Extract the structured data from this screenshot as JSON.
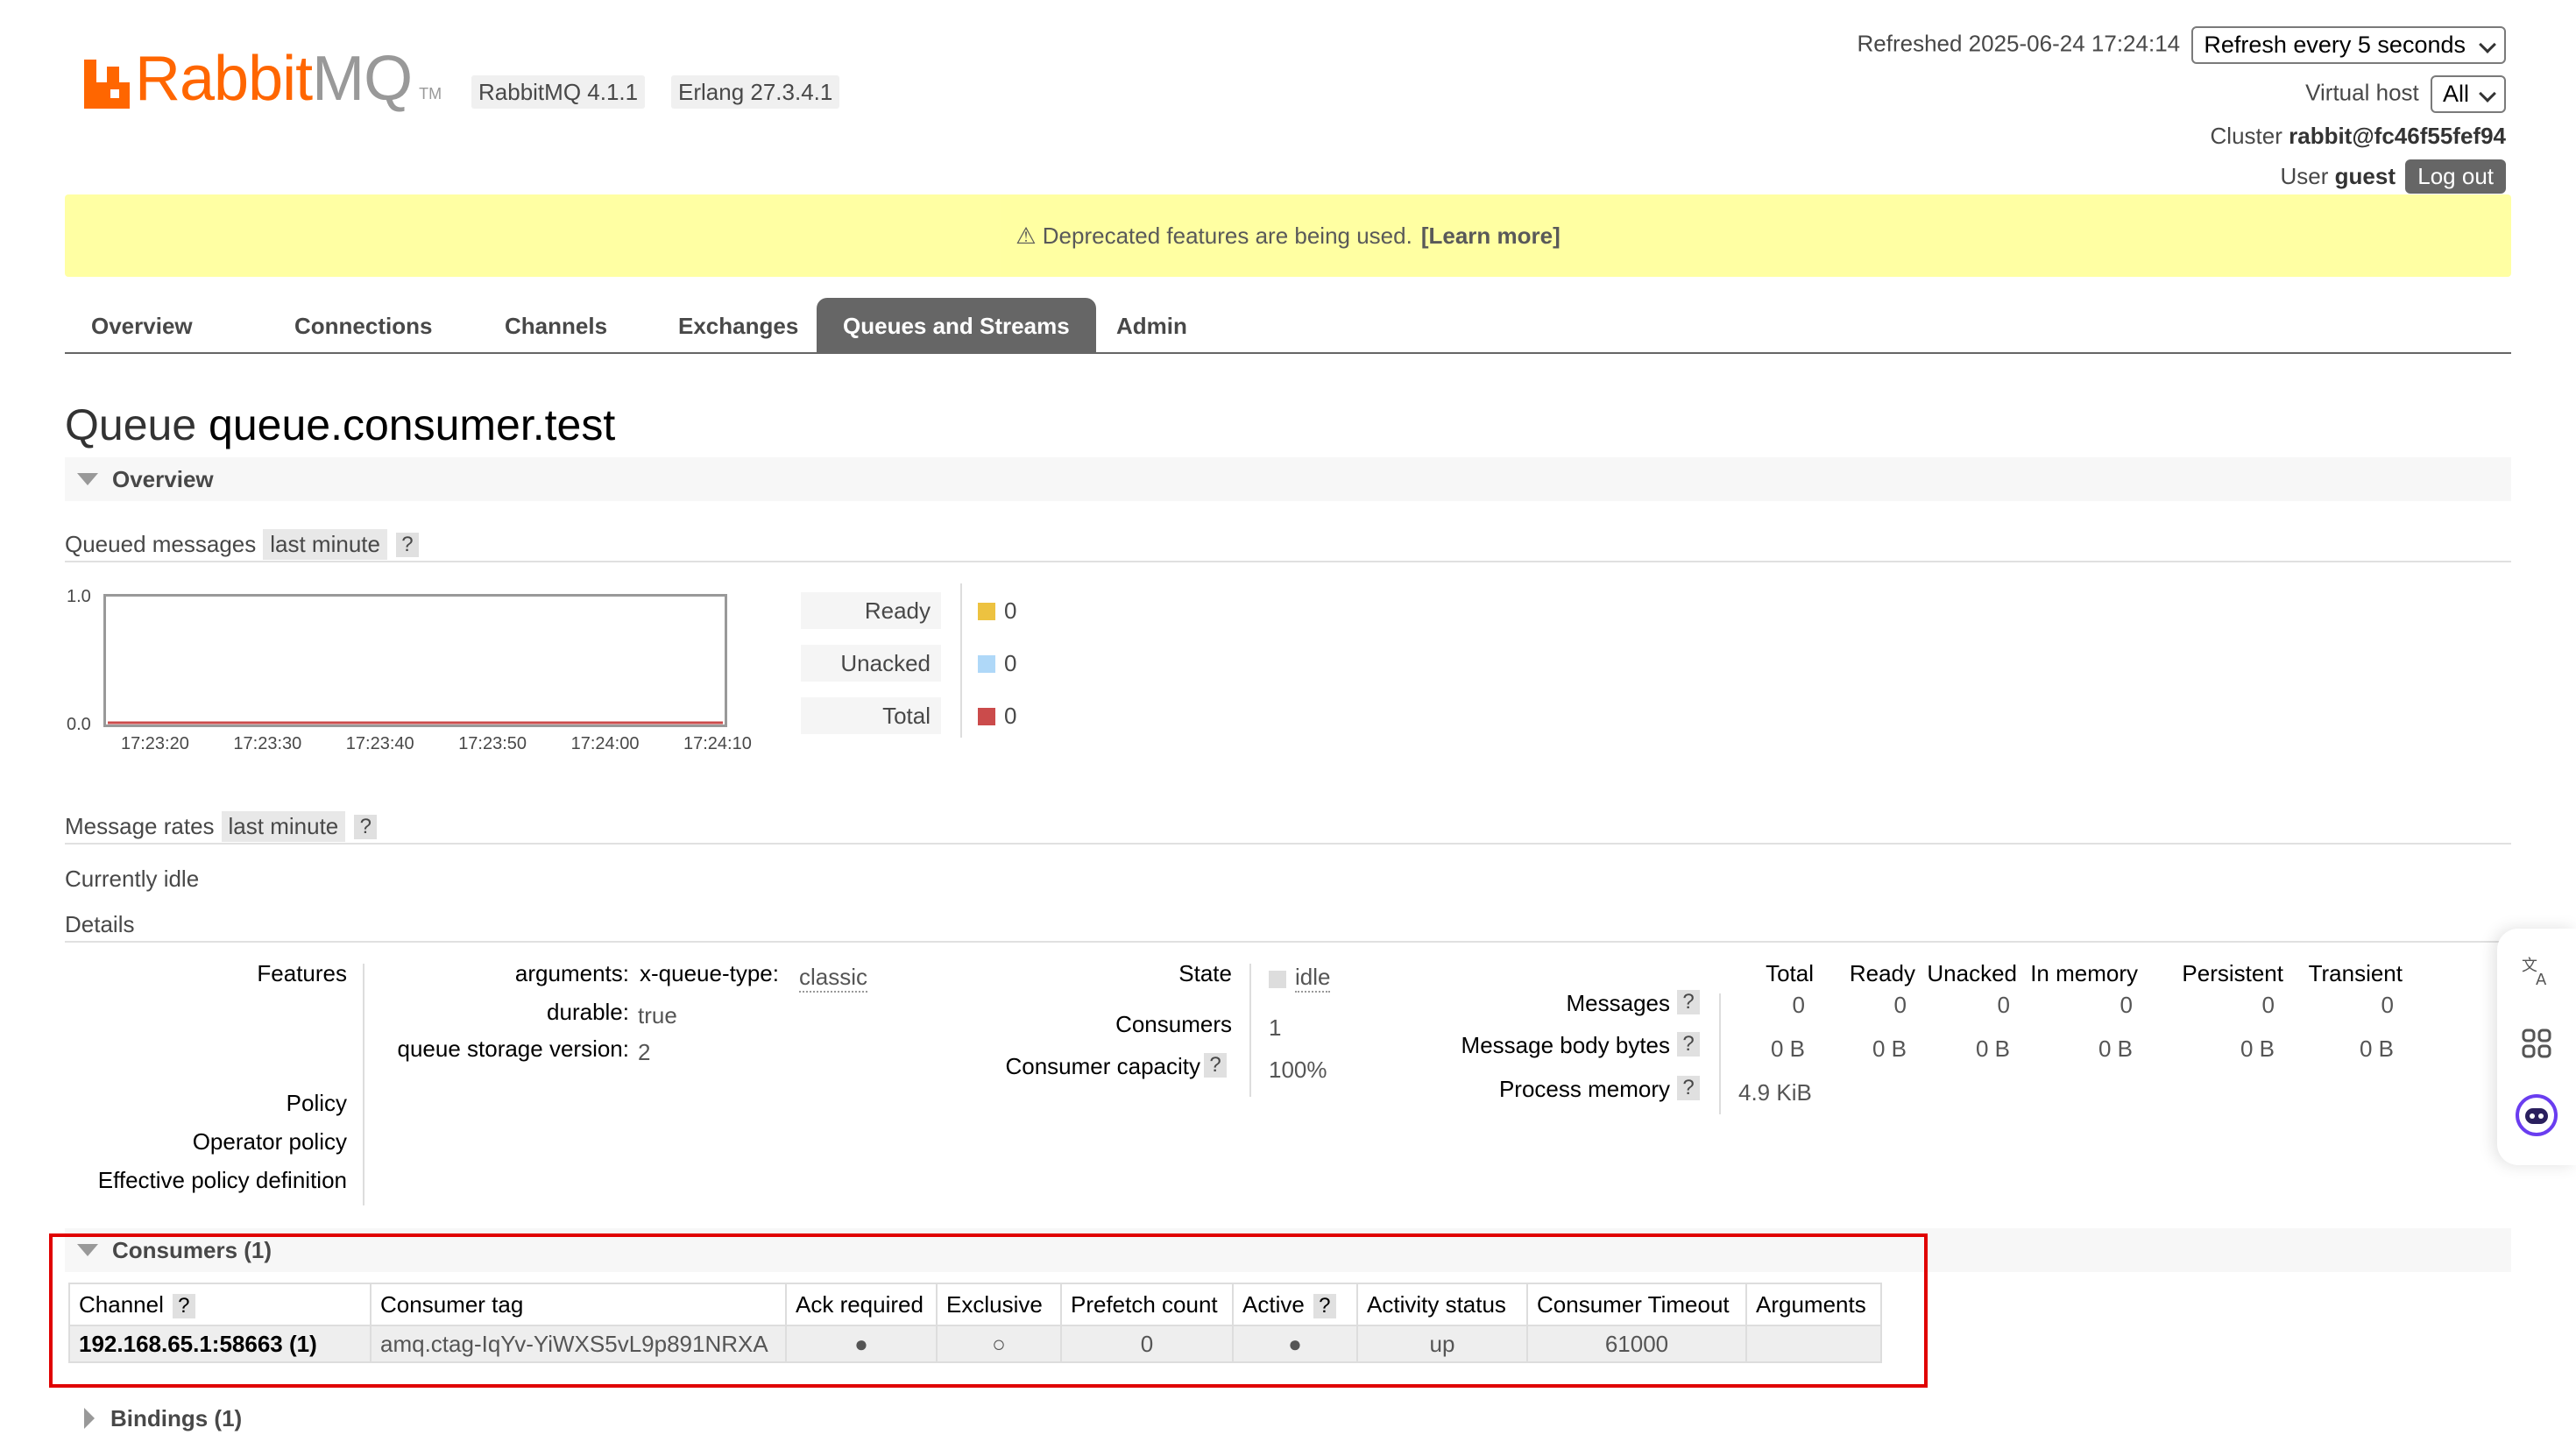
{
  "header": {
    "logo_rabbit": "Rabbit",
    "logo_mq": "MQ",
    "logo_tm": "TM",
    "rabbitmq_version": "RabbitMQ 4.1.1",
    "erlang_version": "Erlang 27.3.4.1",
    "refreshed_label": "Refreshed 2025-06-24 17:24:14",
    "refresh_select": "Refresh every 5 seconds",
    "vhost_label": "Virtual host",
    "vhost_select": "All",
    "cluster_label": "Cluster",
    "cluster_name": "rabbit@fc46f55fef94",
    "user_label": "User",
    "user_name": "guest",
    "logout_label": "Log out"
  },
  "banner": {
    "text": "⚠ Deprecated features are being used.",
    "link": "[Learn more]"
  },
  "tabs": [
    {
      "label": "Overview"
    },
    {
      "label": "Connections"
    },
    {
      "label": "Channels"
    },
    {
      "label": "Exchanges"
    },
    {
      "label": "Queues and Streams"
    },
    {
      "label": "Admin"
    }
  ],
  "page": {
    "title_prefix": "Queue",
    "queue_name": "queue.consumer.test"
  },
  "overview": {
    "section_label": "Overview",
    "queued_messages_label": "Queued messages",
    "range_pill": "last minute",
    "help": "?",
    "message_rates_label": "Message rates",
    "currently_idle": "Currently idle",
    "details_label": "Details"
  },
  "chart_data": {
    "type": "line",
    "x": [
      "17:23:20",
      "17:23:30",
      "17:23:40",
      "17:23:50",
      "17:24:00",
      "17:24:10"
    ],
    "y_tick_labels": [
      "1.0",
      "0.0"
    ],
    "ylim": [
      0,
      1
    ],
    "series": [
      {
        "name": "Ready",
        "color": "#edc240",
        "values": [
          0,
          0,
          0,
          0,
          0,
          0
        ],
        "current": "0"
      },
      {
        "name": "Unacked",
        "color": "#afd8f8",
        "values": [
          0,
          0,
          0,
          0,
          0,
          0
        ],
        "current": "0"
      },
      {
        "name": "Total",
        "color": "#cb4b4b",
        "values": [
          0,
          0,
          0,
          0,
          0,
          0
        ],
        "current": "0"
      }
    ]
  },
  "details": {
    "features_label": "Features",
    "arguments_label": "arguments:",
    "x_queue_type_label": "x-queue-type:",
    "x_queue_type_value": "classic",
    "durable_label": "durable:",
    "durable_value": "true",
    "storage_label": "queue storage version:",
    "storage_value": "2",
    "policy_label": "Policy",
    "operator_policy_label": "Operator policy",
    "effective_policy_label": "Effective policy definition",
    "state_label": "State",
    "state_value": "idle",
    "consumers_label": "Consumers",
    "consumers_value": "1",
    "capacity_label": "Consumer capacity",
    "capacity_value": "100%",
    "stats_headers": [
      "Total",
      "Ready",
      "Unacked",
      "In memory",
      "Persistent",
      "Transient"
    ],
    "messages_label": "Messages",
    "messages_values": [
      "0",
      "0",
      "0",
      "0",
      "0",
      "0"
    ],
    "body_bytes_label": "Message body bytes",
    "body_bytes_values": [
      "0 B",
      "0 B",
      "0 B",
      "0 B",
      "0 B",
      "0 B"
    ],
    "process_memory_label": "Process memory",
    "process_memory_value": "4.9 KiB"
  },
  "consumers": {
    "section_label": "Consumers (1)",
    "columns": [
      "Channel",
      "Consumer tag",
      "Ack required",
      "Exclusive",
      "Prefetch count",
      "Active",
      "Activity status",
      "Consumer Timeout",
      "Arguments"
    ],
    "row": {
      "channel": "192.168.65.1:58663 (1)",
      "tag": "amq.ctag-IqYv-YiWXS5vL9p891NRXA",
      "ack_required": "●",
      "exclusive": "○",
      "prefetch": "0",
      "active": "●",
      "status": "up",
      "timeout": "61000",
      "arguments": ""
    }
  },
  "bindings": {
    "section_label": "Bindings (1)"
  }
}
